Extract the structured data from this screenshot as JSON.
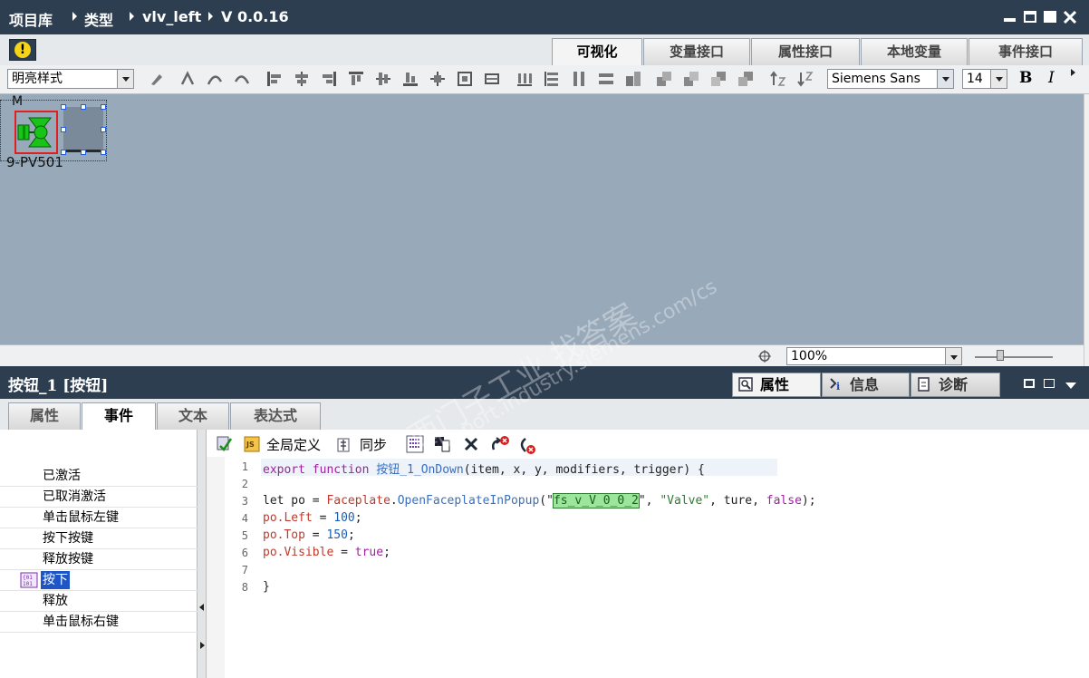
{
  "breadcrumb": [
    "项目库",
    "类型",
    "vlv_left",
    "V 0.0.16"
  ],
  "editor_tabs": [
    {
      "label": "可视化",
      "active": true
    },
    {
      "label": "变量接口",
      "active": false
    },
    {
      "label": "属性接口",
      "active": false
    },
    {
      "label": "本地变量",
      "active": false
    },
    {
      "label": "事件接口",
      "active": false
    }
  ],
  "toolbar": {
    "style_select": "明亮样式",
    "font_select": "Siemens Sans",
    "font_size": "14",
    "bold_label": "B",
    "italic_label": "I"
  },
  "canvas": {
    "object_label_top": "M",
    "object_label_bottom": "9-PV501",
    "zoom_value": "100%"
  },
  "inspector": {
    "title": "按钮_1 [按钮]",
    "tabs": [
      {
        "label": "属性",
        "active": true
      },
      {
        "label": "信息",
        "active": false
      },
      {
        "label": "诊断",
        "active": false
      }
    ]
  },
  "sub_tabs": [
    {
      "label": "属性",
      "active": false
    },
    {
      "label": "事件",
      "active": true
    },
    {
      "label": "文本",
      "active": false
    },
    {
      "label": "表达式",
      "active": false
    }
  ],
  "events": [
    {
      "label": "已激活",
      "selected": false
    },
    {
      "label": "已取消激活",
      "selected": false
    },
    {
      "label": "单击鼠标左键",
      "selected": false
    },
    {
      "label": "按下按键",
      "selected": false
    },
    {
      "label": "释放按键",
      "selected": false
    },
    {
      "label": "按下",
      "selected": true
    },
    {
      "label": "释放",
      "selected": false
    },
    {
      "label": "单击鼠标右键",
      "selected": false
    }
  ],
  "code_toolbar": {
    "global_define_label": "全局定义",
    "sync_label": "同步"
  },
  "code": {
    "line_numbers": [
      "1",
      "2",
      "3",
      "4",
      "5",
      "6",
      "7",
      "8"
    ],
    "l1_kw1": "export",
    "l1_kw2": "function",
    "l1_fn": "按钮_1_OnDown",
    "l1_args": "(item, x, y, modifiers, trigger) {",
    "l3_let": "let po = ",
    "l3_obj": "Faceplate",
    "l3_dot": ".",
    "l3_fn": "OpenFaceplateInPopup",
    "l3_open": "(\"",
    "l3_hl": "fs_v_V_0_0_2",
    "l3_mid": "\", ",
    "l3_str": "\"Valve\"",
    "l3_rest": ", ture, ",
    "l3_false": "false",
    "l3_end": ");",
    "l4_obj": "po",
    "l4_prop": ".Left",
    "l4_eq": " = ",
    "l4_num": "100",
    "l4_end": ";",
    "l5_obj": "po",
    "l5_prop": ".Top",
    "l5_eq": " = ",
    "l5_num": "150",
    "l5_end": ";",
    "l6_obj": "po",
    "l6_prop": ".Visible",
    "l6_eq": " = ",
    "l6_kw": "true",
    "l6_end": ";",
    "l8": "}"
  },
  "watermark": {
    "cn": "西门子工业   找答案",
    "url": "support.industry.siemens.com/cs"
  },
  "colors": {
    "title_bar": "#2d3e50",
    "canvas_bg": "#98a9b9",
    "valve_green": "#19c419",
    "selection_red": "#e02020"
  }
}
